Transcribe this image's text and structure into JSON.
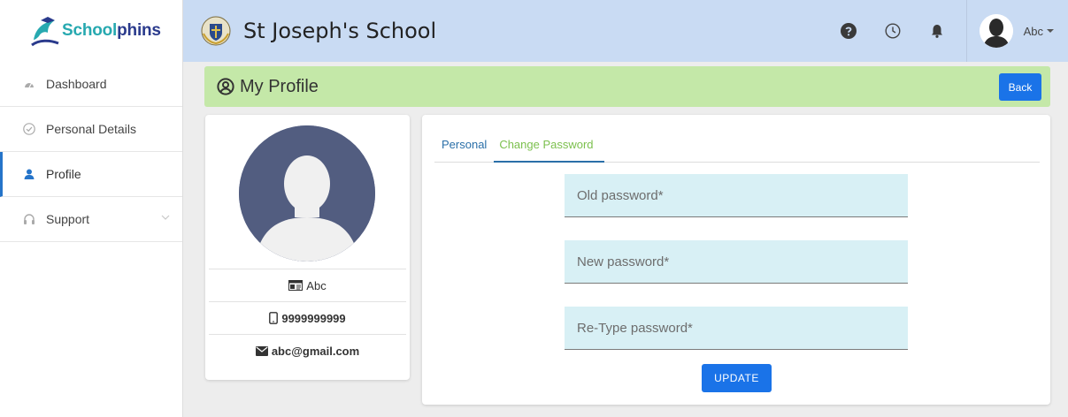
{
  "brand": {
    "part1": "School",
    "part2": "phins"
  },
  "header": {
    "school_name": "St Joseph's School",
    "user_name": "Abc"
  },
  "icons": {
    "help": "question-circle-icon",
    "clock": "clock-icon",
    "bell": "bell-icon",
    "caret": "caret-down-icon"
  },
  "sidebar": {
    "items": [
      {
        "label": "Dashboard",
        "icon": "dashboard-icon"
      },
      {
        "label": "Personal Details",
        "icon": "check-circle-icon"
      },
      {
        "label": "Profile",
        "icon": "user-icon",
        "active": true
      },
      {
        "label": "Support",
        "icon": "headset-icon",
        "has_submenu": true
      }
    ]
  },
  "page": {
    "title": "My Profile",
    "back_label": "Back"
  },
  "profile": {
    "name": "Abc",
    "phone": "9999999999",
    "email": "abc@gmail.com"
  },
  "tabs": [
    {
      "label": "Personal"
    },
    {
      "label": "Change Password",
      "active": true
    }
  ],
  "form": {
    "old_password_placeholder": "Old password*",
    "new_password_placeholder": "New password*",
    "retype_password_placeholder": "Re-Type password*",
    "update_label": "UPDATE"
  },
  "colors": {
    "accent": "#1a73e8",
    "header_bg": "#c9dbf3",
    "title_bg": "#c4e8a8",
    "field_bg": "#d8f0f5",
    "tab_active": "#7cc04e"
  }
}
